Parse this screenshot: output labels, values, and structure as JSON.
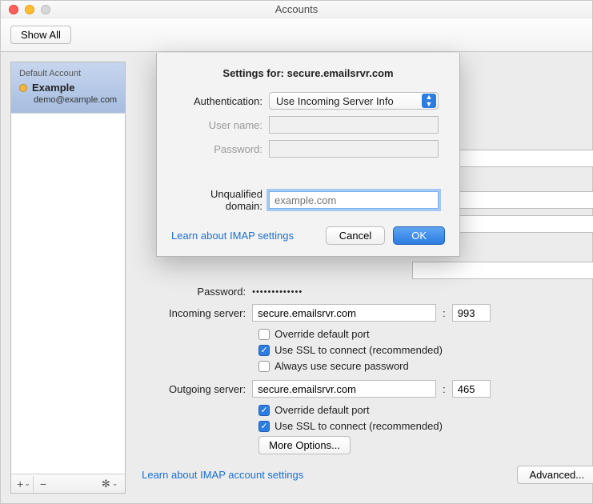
{
  "window": {
    "title": "Accounts"
  },
  "toolbar": {
    "show_all": "Show All"
  },
  "sidebar": {
    "header": "Default Account",
    "account": {
      "name": "Example",
      "email": "demo@example.com"
    },
    "footer": {
      "add": "+",
      "remove": "−",
      "dropdown": "⌄",
      "gear": "✻",
      "gear_dropdown": "⌄"
    }
  },
  "main": {
    "password_label": "Password:",
    "password_value": "•••••••••••••",
    "incoming_label": "Incoming server:",
    "incoming_value": "secure.emailsrvr.com",
    "incoming_port": "993",
    "outgoing_label": "Outgoing server:",
    "outgoing_value": "secure.emailsrvr.com",
    "outgoing_port": "465",
    "chk_override": "Override default port",
    "chk_ssl": "Use SSL to connect (recommended)",
    "chk_secure_pw": "Always use secure password",
    "more_options": "More Options...",
    "learn_link": "Learn about IMAP account settings",
    "advanced": "Advanced..."
  },
  "sheet": {
    "settings_for_label": "Settings for:",
    "settings_for_value": "secure.emailsrvr.com",
    "auth_label": "Authentication:",
    "auth_value": "Use Incoming Server Info",
    "user_label": "User name:",
    "user_value": "",
    "pass_label": "Password:",
    "pass_value": "",
    "domain_label": "Unqualified domain:",
    "domain_placeholder": "example.com",
    "learn_link": "Learn about IMAP settings",
    "cancel": "Cancel",
    "ok": "OK"
  }
}
